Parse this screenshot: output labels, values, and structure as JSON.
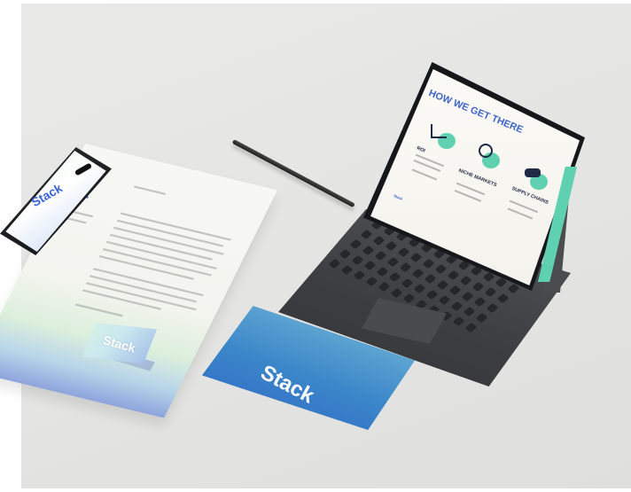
{
  "brand": {
    "logo_text": "Stack"
  },
  "tablet_slide": {
    "title": "HOW WE GET THERE",
    "sections": [
      {
        "label": "ROI",
        "icon": "chart-icon"
      },
      {
        "label": "NICHE MARKETS",
        "icon": "network-icon"
      },
      {
        "label": "SUPPLY CHAINS",
        "icon": "handshake-icon"
      }
    ],
    "footer": "Stack"
  },
  "colors": {
    "accent_teal": "#5fd1b1",
    "brand_blue": "#3b63d8"
  }
}
